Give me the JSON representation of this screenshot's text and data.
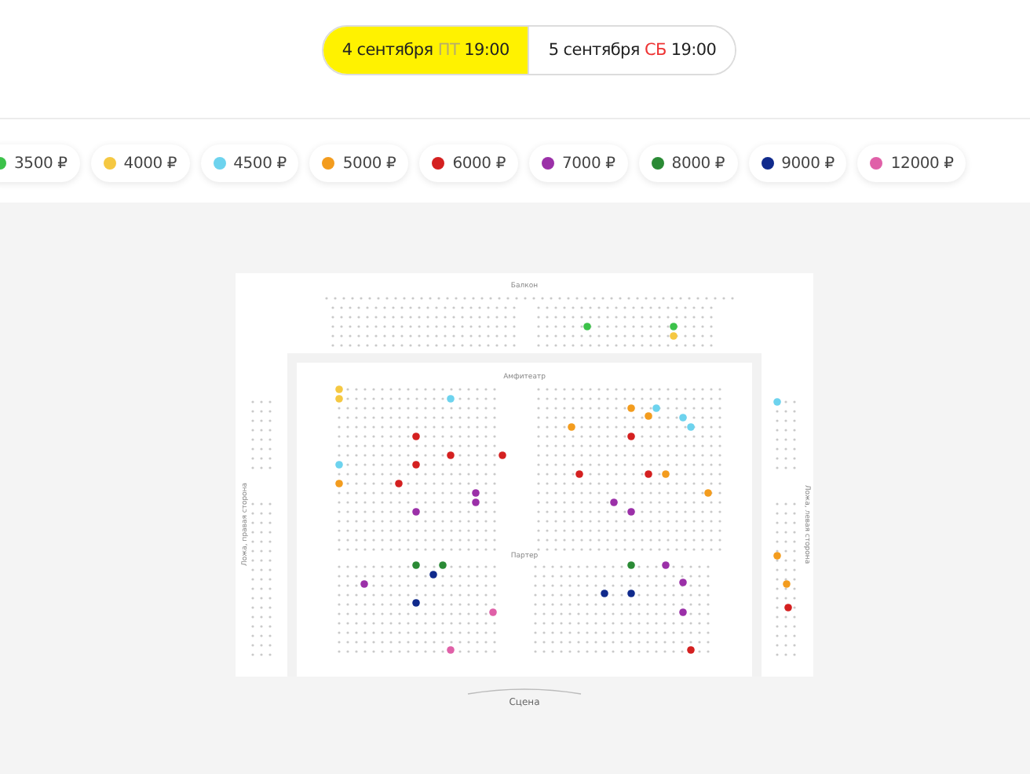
{
  "dates": [
    {
      "date": "4 сентября",
      "weekday": "ПТ",
      "time": "19:00",
      "weekend": false,
      "selected": true
    },
    {
      "date": "5 сентября",
      "weekday": "СБ",
      "time": "19:00",
      "weekend": true,
      "selected": false
    }
  ],
  "prices": [
    {
      "label": "3500 ₽",
      "color": "#3cc24a"
    },
    {
      "label": "4000 ₽",
      "color": "#f5c842"
    },
    {
      "label": "4500 ₽",
      "color": "#6dd3ee"
    },
    {
      "label": "5000 ₽",
      "color": "#f39c1e"
    },
    {
      "label": "6000 ₽",
      "color": "#d42020"
    },
    {
      "label": "7000 ₽",
      "color": "#9b30a8"
    },
    {
      "label": "8000 ₽",
      "color": "#2a8a35"
    },
    {
      "label": "9000 ₽",
      "color": "#102a8c"
    },
    {
      "label": "12000 ₽",
      "color": "#e060a8"
    }
  ],
  "hall": {
    "balcony": "Балкон",
    "amphitheatre": "Амфитеатр",
    "parterre": "Партер",
    "left_box": "Ложа, правая сторона",
    "right_box": "Ложа, левая сторона",
    "stage": "Сцена"
  }
}
